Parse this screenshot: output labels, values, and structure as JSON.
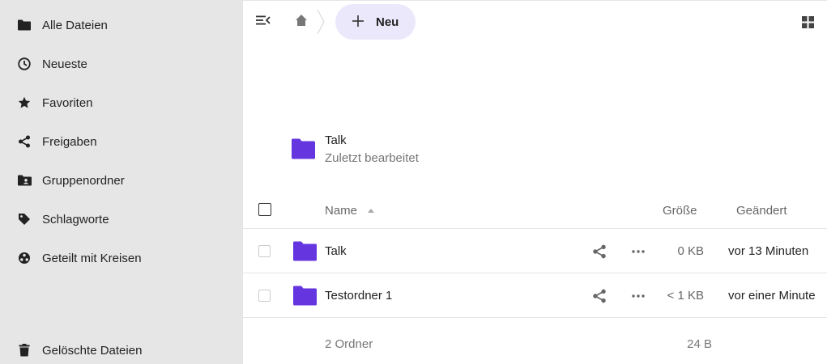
{
  "sidebar": {
    "items": [
      {
        "label": "Alle Dateien",
        "icon": "folder-icon"
      },
      {
        "label": "Neueste",
        "icon": "clock-icon"
      },
      {
        "label": "Favoriten",
        "icon": "star-icon"
      },
      {
        "label": "Freigaben",
        "icon": "share-icon"
      },
      {
        "label": "Gruppenordner",
        "icon": "group-folder-icon"
      },
      {
        "label": "Schlagworte",
        "icon": "tag-icon"
      },
      {
        "label": "Geteilt mit Kreisen",
        "icon": "circles-icon"
      }
    ],
    "trash": {
      "label": "Gelöschte Dateien",
      "icon": "trash-icon"
    }
  },
  "toolbar": {
    "new_label": "Neu"
  },
  "recent": {
    "name": "Talk",
    "subtitle": "Zuletzt bearbeitet"
  },
  "table": {
    "headers": {
      "name": "Name",
      "size": "Größe",
      "modified": "Geändert"
    },
    "rows": [
      {
        "name": "Talk",
        "size": "0 KB",
        "modified": "vor 13 Minuten"
      },
      {
        "name": "Testordner 1",
        "size": "< 1 KB",
        "modified": "vor einer Minute"
      }
    ],
    "summary": {
      "count": "2 Ordner",
      "total": "24 B"
    }
  },
  "colors": {
    "folder": "#6535e0",
    "sidebar_bg": "#e6e6e6",
    "new_button_bg": "#ece8fb"
  }
}
